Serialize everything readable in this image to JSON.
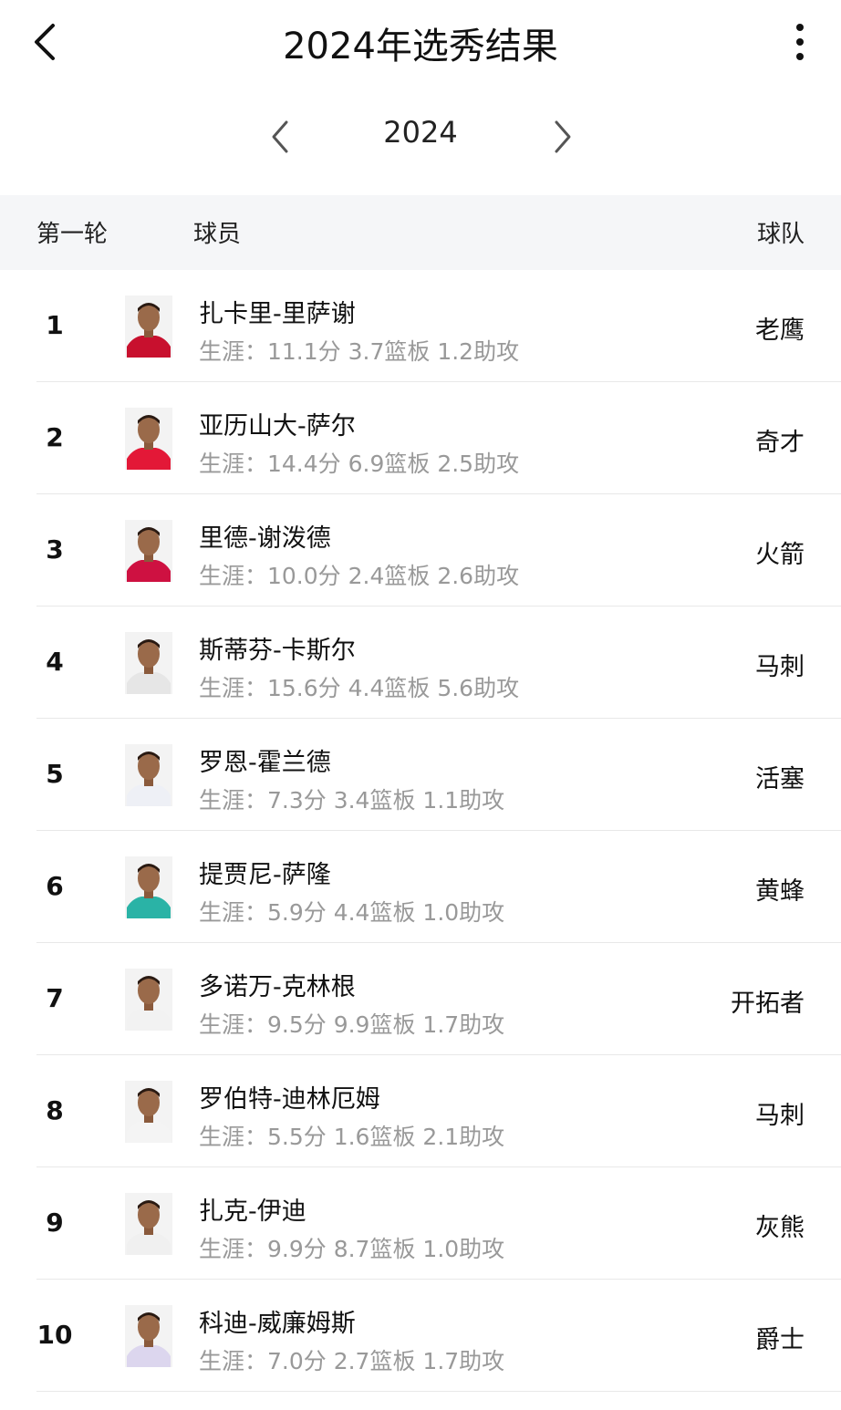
{
  "page_title": "2024年选秀结果",
  "year": "2024",
  "header": {
    "round": "第一轮",
    "player": "球员",
    "team": "球队"
  },
  "picks": [
    {
      "rank": "1",
      "name": "扎卡里-里萨谢",
      "stats": "生涯：11.1分 3.7篮板 1.2助攻",
      "team": "老鹰",
      "jersey": "#c8102e"
    },
    {
      "rank": "2",
      "name": "亚历山大-萨尔",
      "stats": "生涯：14.4分 6.9篮板 2.5助攻",
      "team": "奇才",
      "jersey": "#e31837"
    },
    {
      "rank": "3",
      "name": "里德-谢泼德",
      "stats": "生涯：10.0分 2.4篮板 2.6助攻",
      "team": "火箭",
      "jersey": "#ce1141"
    },
    {
      "rank": "4",
      "name": "斯蒂芬-卡斯尔",
      "stats": "生涯：15.6分 4.4篮板 5.6助攻",
      "team": "马刺",
      "jersey": "#e6e6e6"
    },
    {
      "rank": "5",
      "name": "罗恩-霍兰德",
      "stats": "生涯：7.3分 3.4篮板 1.1助攻",
      "team": "活塞",
      "jersey": "#eef0f6"
    },
    {
      "rank": "6",
      "name": "提贾尼-萨隆",
      "stats": "生涯：5.9分 4.4篮板 1.0助攻",
      "team": "黄蜂",
      "jersey": "#2ab3a6"
    },
    {
      "rank": "7",
      "name": "多诺万-克林根",
      "stats": "生涯：9.5分 9.9篮板 1.7助攻",
      "team": "开拓者",
      "jersey": "#f2f2f2"
    },
    {
      "rank": "8",
      "name": "罗伯特-迪林厄姆",
      "stats": "生涯：5.5分 1.6篮板 2.1助攻",
      "team": "马刺",
      "jersey": "#f4f4f4"
    },
    {
      "rank": "9",
      "name": "扎克-伊迪",
      "stats": "生涯：9.9分 8.7篮板 1.0助攻",
      "team": "灰熊",
      "jersey": "#f0f0f0"
    },
    {
      "rank": "10",
      "name": "科迪-威廉姆斯",
      "stats": "生涯：7.0分 2.7篮板 1.7助攻",
      "team": "爵士",
      "jersey": "#dcd6ee"
    }
  ]
}
